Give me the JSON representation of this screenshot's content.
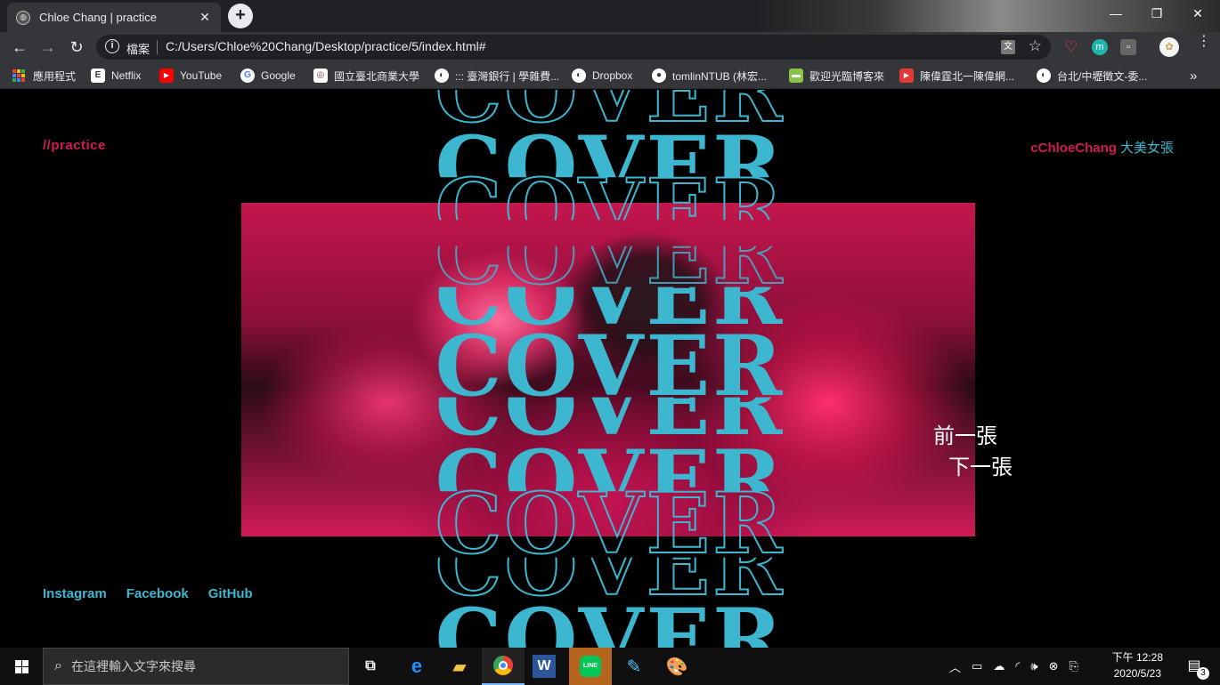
{
  "browser": {
    "tab_title": "Chloe Chang | practice",
    "tab_close": "✕",
    "new_tab": "+",
    "win_minimize": "—",
    "win_maximize": "❐",
    "win_close": "✕",
    "scheme_label": "檔案",
    "url": "C:/Users/Chloe%20Chang/Desktop/practice/5/index.html#",
    "back": "←",
    "forward": "→",
    "reload": "↻",
    "star": "☆"
  },
  "bookmarks": [
    {
      "label": "應用程式",
      "icon": "apps-grid-icon"
    },
    {
      "label": "Netflix",
      "icon": "netflix-icon",
      "color": "#ffffff",
      "glyph": "E"
    },
    {
      "label": "YouTube",
      "icon": "youtube-icon",
      "color": "#ff0000",
      "glyph": "▶"
    },
    {
      "label": "Google",
      "icon": "google-icon",
      "color": "#ffffff",
      "glyph": "G"
    },
    {
      "label": "國立臺北商業大學",
      "icon": "ntub-icon",
      "color": "#ffffff",
      "glyph": "◎"
    },
    {
      "label": "::: 臺灣銀行 | 學雜費...",
      "icon": "globe-icon",
      "color": "#ffffff",
      "glyph": "●"
    },
    {
      "label": "Dropbox",
      "icon": "globe-icon",
      "color": "#ffffff",
      "glyph": "●"
    },
    {
      "label": "tomlinNTUB (林宏...",
      "icon": "github-icon",
      "color": "#ffffff",
      "glyph": "●"
    },
    {
      "label": "歡迎光臨博客來",
      "icon": "books-icon",
      "color": "#8bc34a",
      "glyph": "▬"
    },
    {
      "label": "陳偉霆北一陳偉網...",
      "icon": "video-icon",
      "color": "#e53935",
      "glyph": "▶"
    },
    {
      "label": "台北/中壢徵文-委...",
      "icon": "globe-icon",
      "color": "#ffffff",
      "glyph": "●"
    }
  ],
  "bookmarks_more": "»",
  "page": {
    "brand_left": "//practice",
    "brand_right_name": "cChloeChang",
    "brand_right_alias": "大美女張",
    "cover_word": "COVER",
    "prev_label": "前一張",
    "next_label": "下一張",
    "social": [
      "Instagram",
      "Facebook",
      "GitHub"
    ],
    "colors": {
      "accent_cyan": "#3db6cf",
      "accent_pink": "#d11a5a"
    }
  },
  "taskbar": {
    "search_placeholder": "在這裡輸入文字來搜尋",
    "time_line1": "下午 12:28",
    "time_line2": "2020/5/23",
    "notification_count": "3"
  }
}
